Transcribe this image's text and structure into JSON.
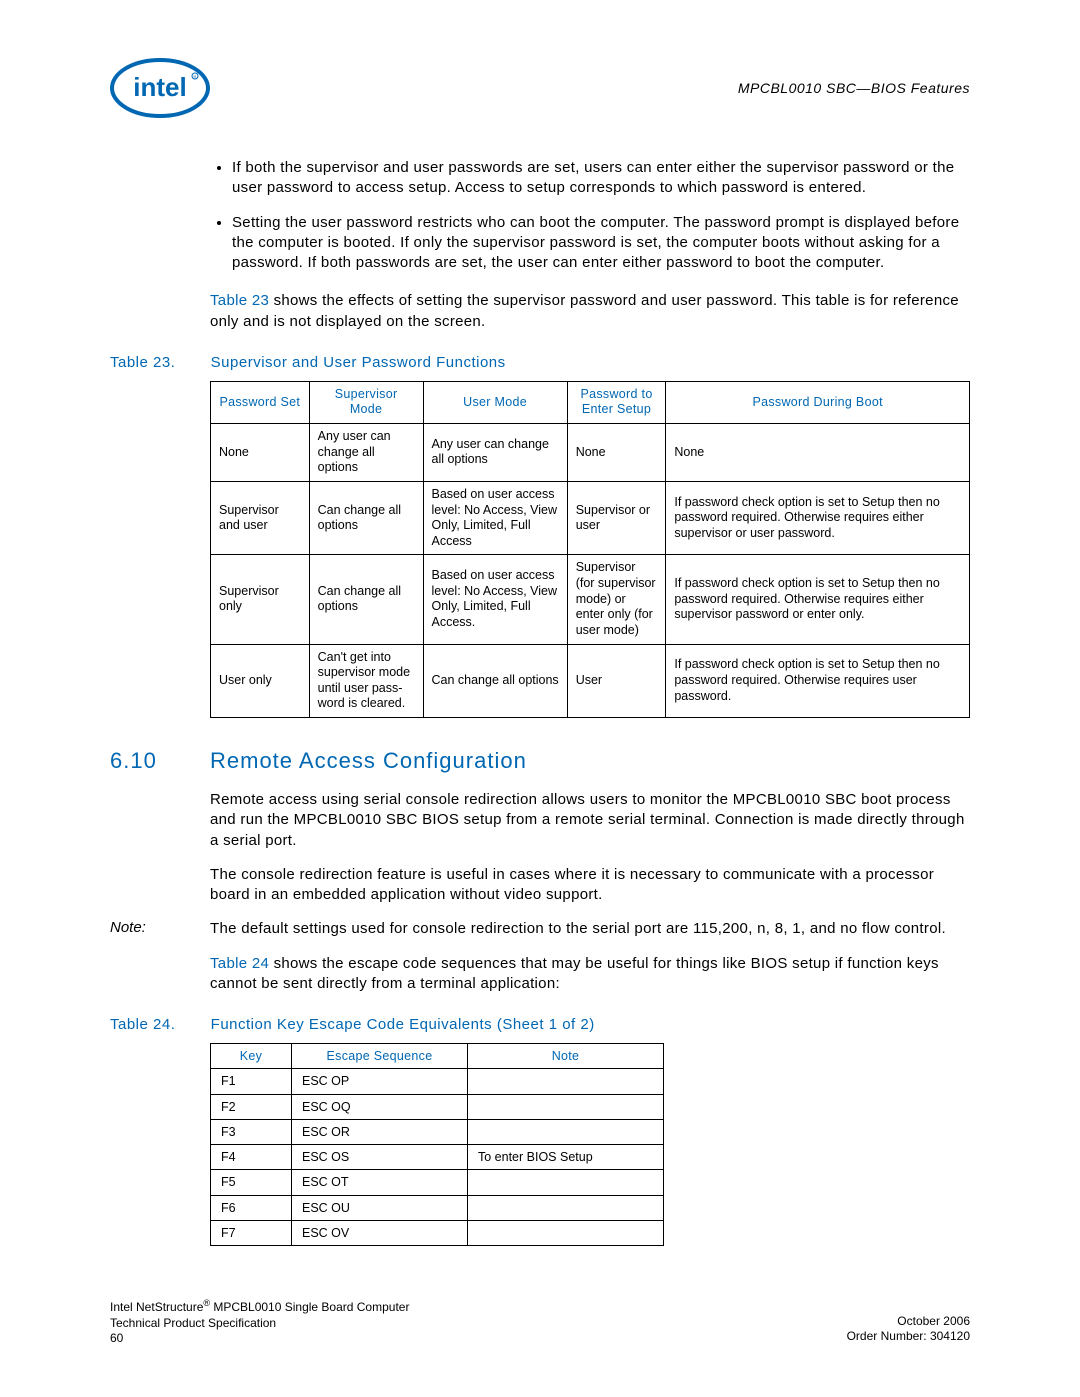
{
  "header": {
    "right": "MPCBL0010 SBC—BIOS Features"
  },
  "bullets": [
    "If both the supervisor and user passwords are set, users can enter either the supervisor password or the user password to access setup. Access to setup corresponds to which password is entered.",
    "Setting the user password restricts who can boot the computer. The password prompt is displayed before the computer is booted. If only the supervisor password is set, the computer boots without asking for a password. If both passwords are set, the user can enter either password to boot the computer."
  ],
  "para_intro_pre": "Table 23",
  "para_intro_post": " shows the effects of setting the supervisor password and user password. This table is for reference only and is not displayed on the screen.",
  "table23": {
    "caption_label": "Table 23.",
    "caption_title": "Supervisor and User Password Functions",
    "headers": [
      "Password Set",
      "Supervisor Mode",
      "User Mode",
      "Password to Enter Setup",
      "Password During Boot"
    ],
    "rows": [
      [
        "None",
        "Any user can change all options",
        "Any user can change all options",
        "None",
        "None"
      ],
      [
        "Supervisor and user",
        "Can change all options",
        "Based on user access level: No Access, View Only, Limited, Full Access",
        "Supervisor or user",
        "If password check option is set to Setup then no password required. Otherwise requires either supervisor or user password."
      ],
      [
        "Supervisor only",
        "Can change all options",
        "Based on user access level: No Access, View Only, Limited, Full Access.",
        "Supervisor (for supervisor mode) or enter only (for user mode)",
        "If password check option is set to Setup then no password required. Otherwise requires either supervisor password or enter only."
      ],
      [
        "User only",
        "Can't get into supervisor mode until user pass-word is cleared.",
        "Can change all options",
        "User",
        "If password check option is set to Setup then no password required. Otherwise requires user password."
      ]
    ]
  },
  "section": {
    "num": "6.10",
    "title": "Remote Access Configuration"
  },
  "para_remote1": "Remote access using serial console redirection allows users to monitor the MPCBL0010 SBC boot process and run the MPCBL0010 SBC BIOS setup from a remote serial terminal. Connection is made directly through a serial port.",
  "para_remote2": "The console redirection feature is useful in cases where it is necessary to communicate with a processor board in an embedded application without video support.",
  "note": {
    "label": "Note:",
    "text": "The default settings used for console redirection to the serial port are 115,200, n, 8, 1, and no flow control."
  },
  "para_escape_pre": "Table 24",
  "para_escape_post": " shows the escape code sequences that may be useful for things like BIOS setup if function keys cannot be sent directly from a terminal application:",
  "table24": {
    "caption_label": "Table 24.",
    "caption_title": "Function Key Escape Code Equivalents  (Sheet 1 of 2)",
    "headers": [
      "Key",
      "Escape Sequence",
      "Note"
    ],
    "rows": [
      [
        "F1",
        "ESC OP",
        ""
      ],
      [
        "F2",
        "ESC OQ",
        ""
      ],
      [
        "F3",
        "ESC OR",
        ""
      ],
      [
        "F4",
        "ESC OS",
        "To enter BIOS Setup"
      ],
      [
        "F5",
        "ESC OT",
        ""
      ],
      [
        "F6",
        "ESC OU",
        ""
      ],
      [
        "F7",
        "ESC OV",
        ""
      ]
    ]
  },
  "footer": {
    "left1": "Intel NetStructure",
    "left1b": " MPCBL0010 Single Board Computer",
    "left2": "Technical Product Specification",
    "left3": "60",
    "right1": "October 2006",
    "right2": "Order Number: 304120"
  }
}
